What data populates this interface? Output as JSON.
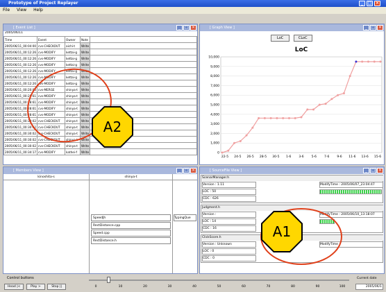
{
  "app": {
    "title": "Prototype of Project Replayer"
  },
  "menu": [
    "File",
    "View",
    "Help"
  ],
  "event_list": {
    "title": "[ Event List ]",
    "date_label": "2005/06/11",
    "columns": [
      "Time",
      "Event",
      "Owner",
      "Note"
    ],
    "rows": [
      [
        "2005/06/11_00:04:00",
        "cvs-CHECKOUT",
        "aichi-t",
        "Write"
      ],
      [
        "2005/06/11_00:12:26",
        "cvs-MODIFY",
        "kettai-g",
        "Write"
      ],
      [
        "2005/06/11_00:12:26",
        "cvs-MODIFY",
        "kettai-g",
        "Write"
      ],
      [
        "2005/06/11_00:12:26",
        "cvs-MODIFY",
        "kettai-g",
        "Write"
      ],
      [
        "2005/06/11_00:12:26",
        "cvs-MODIFY",
        "kettai-g",
        "Write"
      ],
      [
        "2005/06/11_00:12:26",
        "cvs-MODIFY",
        "kettai-g",
        "Write"
      ],
      [
        "2005/06/11_00:12:26",
        "cvs-MODIFY",
        "kettai-g",
        "Write"
      ],
      [
        "2005/06/11_00:20:00",
        "cvs-MERGE",
        "shinya-t",
        "Write"
      ],
      [
        "2005/06/11_00:28:61",
        "cvs-MODIFY",
        "shinya-t",
        "Write"
      ],
      [
        "2005/06/11_00:28:61",
        "cvs-MODIFY",
        "shinya-t",
        "Write"
      ],
      [
        "2005/06/11_00:28:61",
        "cvs-MODIFY",
        "shinya-t",
        "Write"
      ],
      [
        "2005/06/11_00:28:61",
        "cvs-MODIFY",
        "shinya-t",
        "Write"
      ],
      [
        "2005/06/11_00:30:02",
        "cvs-CHECKOUT",
        "shinya-t",
        "Write"
      ],
      [
        "2005/06/11_00:30:02",
        "cvs-CHECKOUT",
        "shinya-t",
        "Write"
      ],
      [
        "2005/06/11_00:30:02",
        "cvs-CHECKOUT",
        "shinya-t",
        "Write"
      ],
      [
        "2005/06/11_00:30:02",
        "cvs-CHECKOUT",
        "shinya-t",
        "Write"
      ],
      [
        "2005/06/11_00:30:02",
        "cvs-CHECKOUT",
        "shinya-t",
        "Write"
      ],
      [
        "2005/06/11_00:34:17",
        "cvs-MODIFY",
        "kathei-f",
        "Write"
      ]
    ]
  },
  "graph_view": {
    "title": "[ Graph View ]",
    "buttons": [
      "LoC",
      "CLoC"
    ]
  },
  "chart_data": {
    "type": "line",
    "title": "LoC",
    "x": [
      "22-5",
      "24-5",
      "26-5",
      "28-5",
      "30-5",
      "1-6",
      "3-6",
      "5-6",
      "7-6",
      "9-6",
      "11-6",
      "13-6",
      "15-6"
    ],
    "y_ticks": [
      "0",
      "1,000",
      "2,000",
      "3,000",
      "4,000",
      "5,000",
      "6,000",
      "7,000",
      "8,000",
      "9,000",
      "10,000"
    ],
    "ylim": [
      0,
      10000
    ],
    "series": [
      {
        "values": [
          0,
          200,
          1000,
          1200,
          1800,
          2600,
          3600,
          3600,
          3600,
          3600,
          3600,
          3600,
          3600,
          3700,
          4500,
          4500,
          5000,
          5100,
          5600,
          6000,
          6200,
          8000,
          9500,
          9500,
          9500,
          9500,
          9500
        ]
      }
    ],
    "color": "#f0a0a0"
  },
  "members_view": {
    "title": "[ Members View ]",
    "members": [
      "kinoshita-s",
      "shinya-t"
    ],
    "files": [
      "SpeedJh",
      "RectDistance.cpp",
      "Speed.cpp",
      "RectDistance.h"
    ],
    "extra": "TypingQue"
  },
  "sourcefile_view": {
    "title": "[ SourceFile View ]",
    "files": [
      {
        "name": "ScenarManager.h",
        "version": "Version : 1.11",
        "modify": "ModifyTime : 2005/06/07_23:04:47",
        "loc": "LOC : 50",
        "cdc": "CDC : 626"
      },
      {
        "name": "Judgment.h",
        "version": "Version :",
        "modify": "ModifyTime : 2005/06/10_13:18:07",
        "loc": "LOC : 14",
        "cdc": "CDC : 16"
      },
      {
        "name": "ClickScore.h",
        "version": "Version : Unknown",
        "modify": "ModifyTime :",
        "loc": "LOC : 0",
        "cdc": "CDC : 0"
      }
    ]
  },
  "control": {
    "label": "Control buttons",
    "buttons": [
      "Head |<",
      "Play >",
      "Stop ||"
    ],
    "slider_ticks": [
      "0",
      "10",
      "20",
      "30",
      "40",
      "50",
      "60",
      "70",
      "80",
      "90",
      "100"
    ],
    "slider_value_percent": 5,
    "current_label": "Current date",
    "current_value": "2005/06/1"
  },
  "annotations": [
    "A1",
    "A2"
  ]
}
